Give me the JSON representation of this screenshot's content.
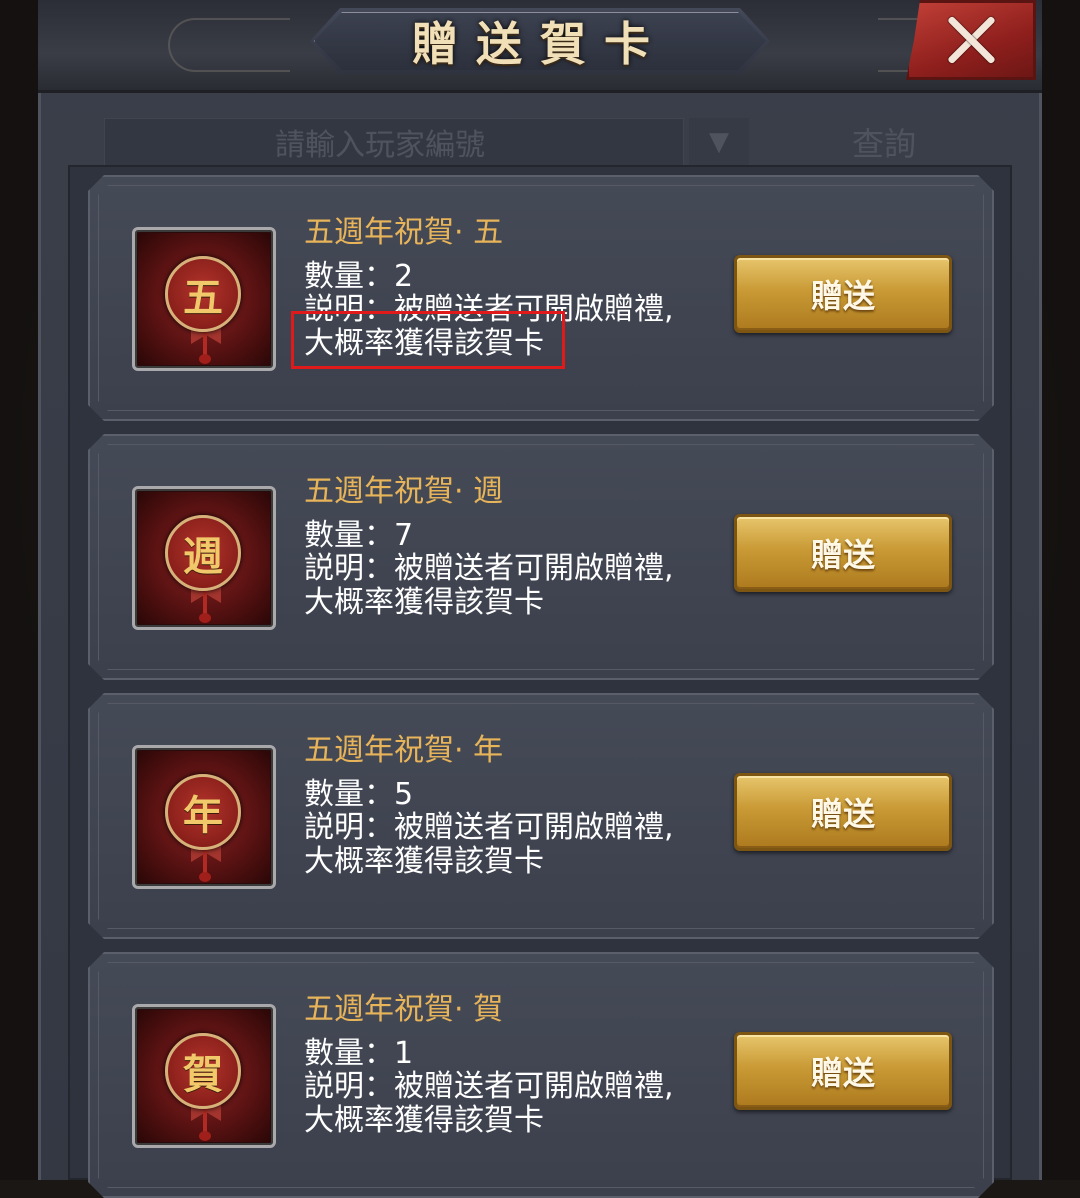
{
  "header": {
    "title": "贈送賀卡",
    "close_label": ""
  },
  "search": {
    "placeholder": "請輸入玩家編號",
    "dropdown_glyph": "▼",
    "button_label": "查詢"
  },
  "cards": [
    {
      "title": "五週年祝賀· 五",
      "qty_label": "數量：",
      "qty": "2",
      "desc_label": "説明：",
      "desc_line1": "被贈送者可開啟贈禮,",
      "desc_line2": "大概率獲得該賀卡",
      "glyph": "五",
      "button": "贈送"
    },
    {
      "title": "五週年祝賀· 週",
      "qty_label": "數量：",
      "qty": "7",
      "desc_label": "説明：",
      "desc_line1": "被贈送者可開啟贈禮,",
      "desc_line2": "大概率獲得該賀卡",
      "glyph": "週",
      "button": "贈送"
    },
    {
      "title": "五週年祝賀· 年",
      "qty_label": "數量：",
      "qty": "5",
      "desc_label": "説明：",
      "desc_line1": "被贈送者可開啟贈禮,",
      "desc_line2": "大概率獲得該賀卡",
      "glyph": "年",
      "button": "贈送"
    },
    {
      "title": "五週年祝賀· 賀",
      "qty_label": "數量：",
      "qty": "1",
      "desc_label": "説明：",
      "desc_line1": "被贈送者可開啟贈禮,",
      "desc_line2": "大概率獲得該賀卡",
      "glyph": "賀",
      "button": "贈送"
    }
  ],
  "colors": {
    "title_gold": "#e8b45a",
    "button_gold": "#c99a35",
    "close_red": "#a8302a",
    "highlight_red": "#e0191b"
  }
}
